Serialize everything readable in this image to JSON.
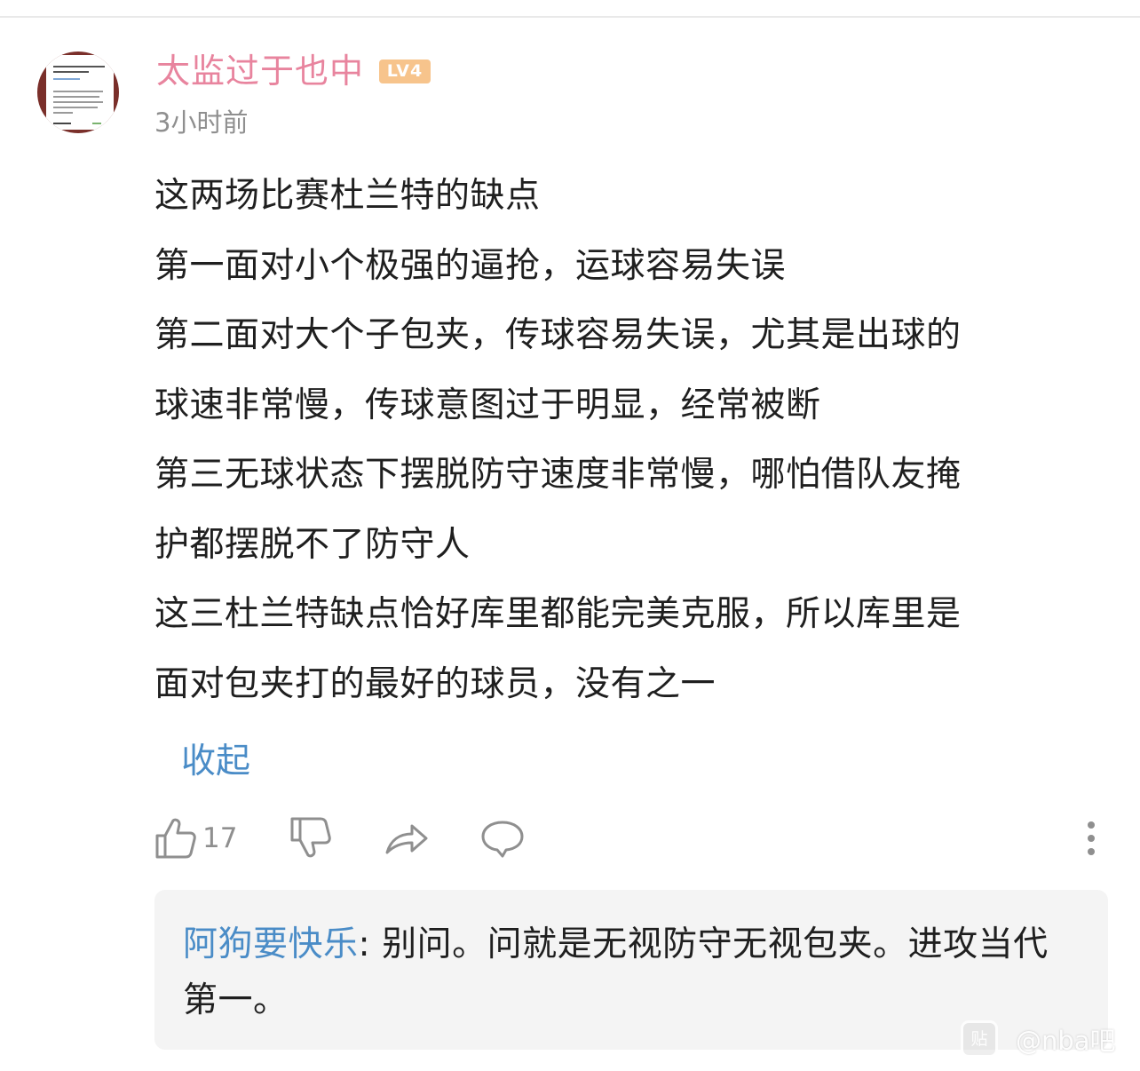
{
  "comment": {
    "username": "太监过于也中",
    "level_badge": "LV4",
    "timestamp": "3小时前",
    "body_lines": [
      "这两场比赛杜兰特的缺点",
      "第一面对小个极强的逼抢，运球容易失误",
      "第二面对大个子包夹，传球容易失误，尤其是出球的",
      "球速非常慢，传球意图过于明显，经常被断",
      "第三无球状态下摆脱防守速度非常慢，哪怕借队友掩",
      "护都摆脱不了防守人",
      "这三杜兰特缺点恰好库里都能完美克服，所以库里是",
      "面对包夹打的最好的球员，没有之一"
    ],
    "collapse_label": "收起"
  },
  "actions": {
    "like_icon": "thumbs-up-icon",
    "like_count": "17",
    "dislike_icon": "thumbs-down-icon",
    "share_icon": "share-arrow-icon",
    "reply_icon": "chat-bubble-icon",
    "more_icon": "more-vertical-icon"
  },
  "reply": {
    "author": "阿狗要快乐",
    "separator": ": ",
    "text": "别问。问就是无视防守无视包夹。进攻当代第一。"
  },
  "watermark": {
    "logo_text": "贴",
    "text": "@nba吧"
  },
  "colors": {
    "username": "#e8849e",
    "level_badge": "#f7c48c",
    "link": "#4a8cc7",
    "muted": "#8f8f8f",
    "reply_bg": "#f4f4f4"
  }
}
